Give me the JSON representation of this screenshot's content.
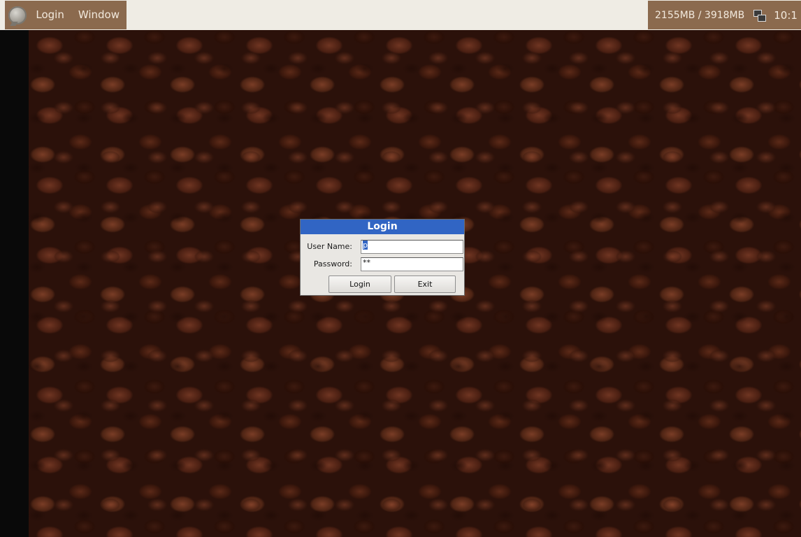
{
  "panel": {
    "menus": [
      "Login",
      "Window"
    ],
    "memory": "2155MB / 3918MB",
    "clock": "10:1"
  },
  "icons": {
    "menu": "app-menu-icon",
    "network": "network-icon"
  },
  "colors": {
    "panel_bg": "#efece4",
    "panel_accent": "#8b6a4e",
    "title_bar": "#3165c4",
    "dialog_bg": "#e9e7e3"
  },
  "dialog": {
    "title": "Login",
    "username_label": "User Name:",
    "username_value": "p",
    "password_label": "Password:",
    "password_value": "**",
    "login_button": "Login",
    "exit_button": "Exit"
  }
}
